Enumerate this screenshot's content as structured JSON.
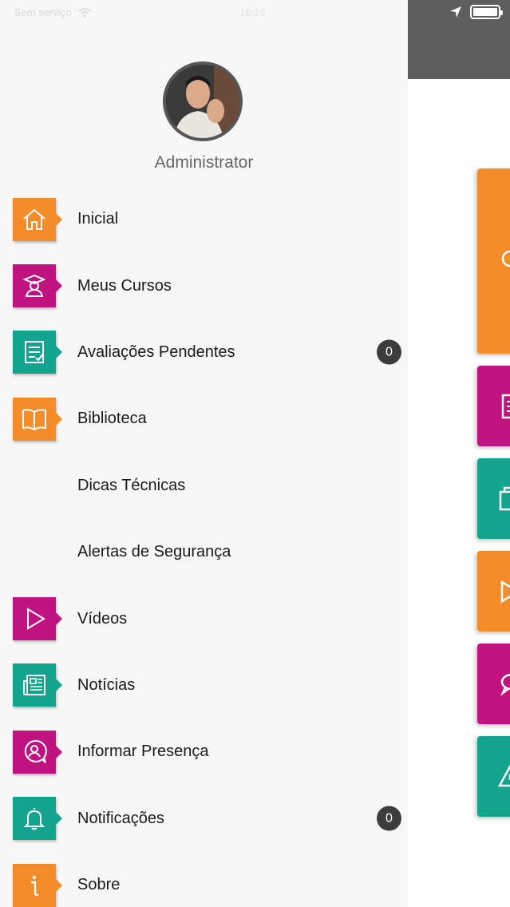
{
  "status_bar": {
    "carrier": "Sem serviço",
    "time": "16:16"
  },
  "user": {
    "name": "Administrator",
    "avatar_icon": "user-photo"
  },
  "menu": [
    {
      "label": "Inicial",
      "icon": "home-icon",
      "color": "#f58c2a"
    },
    {
      "label": "Meus Cursos",
      "icon": "graduate-icon",
      "color": "#c0137f"
    },
    {
      "label": "Avaliações Pendentes",
      "icon": "checklist-icon",
      "color": "#12a48c",
      "badge": "0"
    },
    {
      "label": "Biblioteca",
      "icon": "book-icon",
      "color": "#f58c2a"
    },
    {
      "label": "Dicas Técnicas"
    },
    {
      "label": "Alertas de Segurança"
    },
    {
      "label": "Vídeos",
      "icon": "play-icon",
      "color": "#c0137f"
    },
    {
      "label": "Notícias",
      "icon": "newspaper-icon",
      "color": "#12a48c"
    },
    {
      "label": "Informar Presença",
      "icon": "user-chat-icon",
      "color": "#c0137f"
    },
    {
      "label": "Notificações",
      "icon": "bell-icon",
      "color": "#12a48c",
      "badge": "0"
    },
    {
      "label": "Sobre",
      "icon": "info-icon",
      "color": "#f58c2a"
    }
  ],
  "background_tiles": [
    {
      "color": "#f58c2a",
      "icon": "lightbulb-icon"
    },
    {
      "color": "#c0137f",
      "icon": "checklist-icon"
    },
    {
      "color": "#12a48c",
      "icon": "book-icon"
    },
    {
      "color": "#f58c2a",
      "icon": "play-icon"
    },
    {
      "color": "#c0137f",
      "icon": "chat-icon"
    },
    {
      "color": "#12a48c",
      "icon": "warning-icon"
    }
  ]
}
